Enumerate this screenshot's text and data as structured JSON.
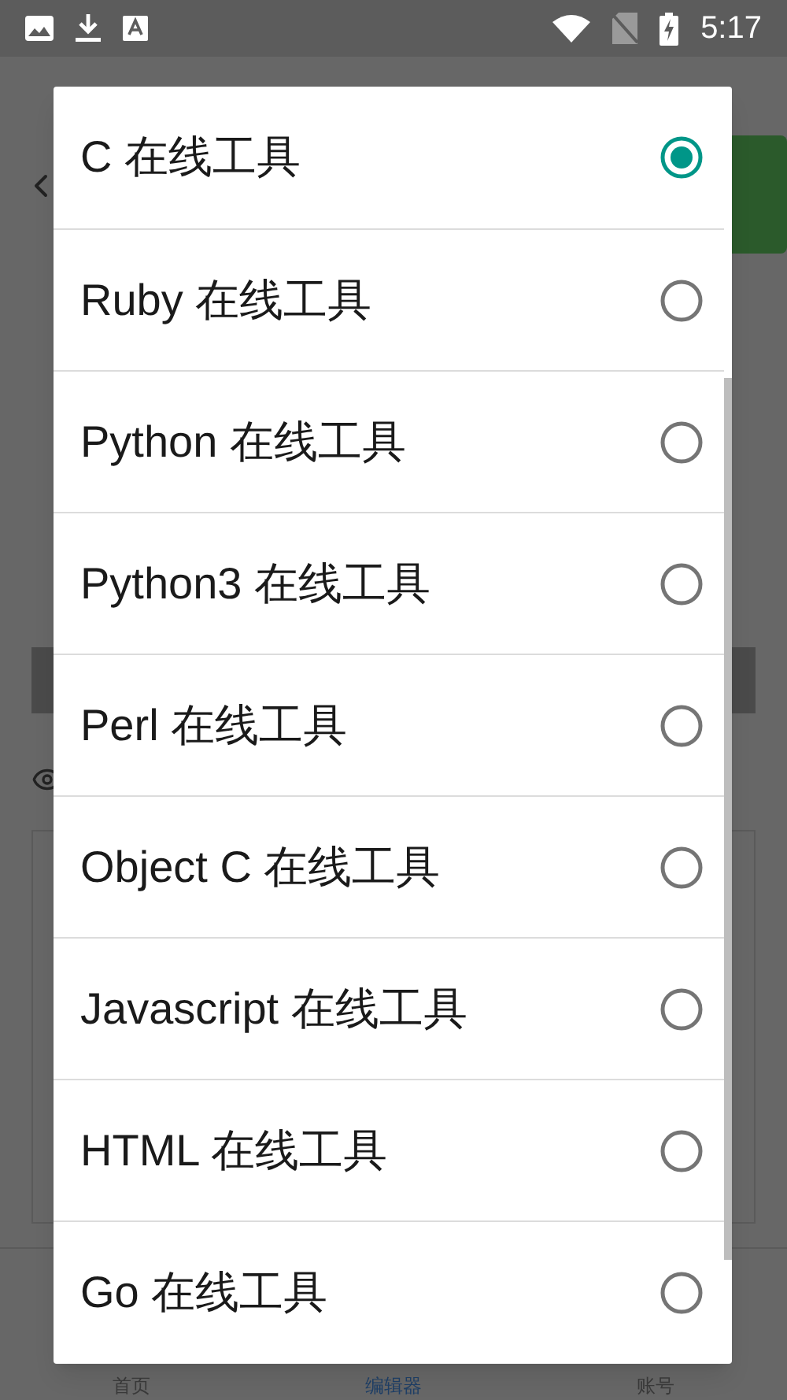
{
  "status_bar": {
    "time": "5:17"
  },
  "bottom_nav": [
    {
      "label": "首页",
      "selected": false
    },
    {
      "label": "编辑器",
      "selected": true
    },
    {
      "label": "账号",
      "selected": false
    }
  ],
  "dialog": {
    "options": [
      {
        "label": "C 在线工具",
        "selected": true
      },
      {
        "label": "Ruby 在线工具",
        "selected": false
      },
      {
        "label": "Python 在线工具",
        "selected": false
      },
      {
        "label": "Python3 在线工具",
        "selected": false
      },
      {
        "label": "Perl 在线工具",
        "selected": false
      },
      {
        "label": "Object C 在线工具",
        "selected": false
      },
      {
        "label": "Javascript 在线工具",
        "selected": false
      },
      {
        "label": "HTML 在线工具",
        "selected": false
      },
      {
        "label": "Go 在线工具",
        "selected": false
      }
    ]
  }
}
